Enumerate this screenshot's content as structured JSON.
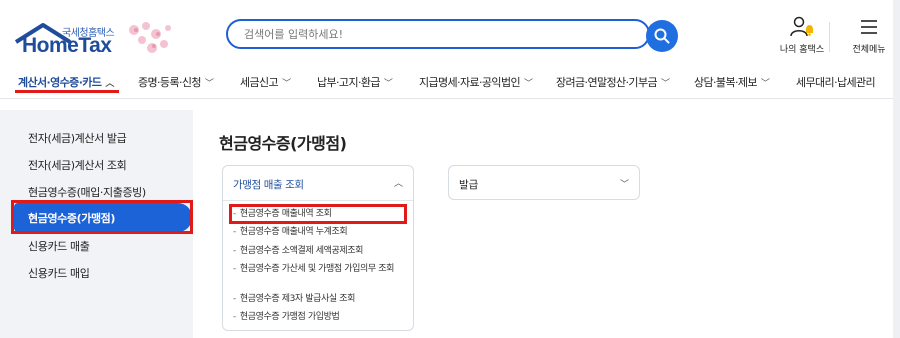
{
  "logo": {
    "subtitle": "국세청홈택스",
    "title": "HomeTax"
  },
  "search": {
    "placeholder": "검색어를 입력하세요!"
  },
  "utility": {
    "my_hometax": "나의 홈택스",
    "all_menu": "전체메뉴"
  },
  "nav": {
    "items": [
      {
        "label": "계산서·영수증·카드",
        "active": true
      },
      {
        "label": "증명·등록·신청"
      },
      {
        "label": "세금신고"
      },
      {
        "label": "납부·고지·환급"
      },
      {
        "label": "지급명세·자료·공익법인"
      },
      {
        "label": "장려금·연말정산·기부금"
      },
      {
        "label": "상담·불복·제보"
      },
      {
        "label": "세무대리·납세관리"
      }
    ]
  },
  "sidebar": {
    "items": [
      {
        "label": "전자(세금)계산서 발급"
      },
      {
        "label": "전자(세금)계산서 조회"
      },
      {
        "label": "현금영수증(매입·지출증빙)"
      },
      {
        "label": "현금영수증(가맹점)",
        "active": true
      },
      {
        "label": "신용카드 매출"
      },
      {
        "label": "신용카드 매입"
      }
    ]
  },
  "main": {
    "title": "현금영수증(가맹점)",
    "card1": {
      "title": "가맹점 매출 조회",
      "items": [
        "현금영수증 매출내역 조회",
        "현금영수증 매출내역 누계조회",
        "현금영수증 소액결제 세액공제조회",
        "현금영수증 가산세 및 가맹점 가입의무 조회",
        "현금영수증 제3자 발급사실 조회",
        "현금영수증 가맹점 가입방법"
      ]
    },
    "card2": {
      "title": "발급"
    }
  },
  "colors": {
    "accent": "#1d63d8",
    "highlight": "#e01919",
    "brand": "#1f4c9b"
  }
}
